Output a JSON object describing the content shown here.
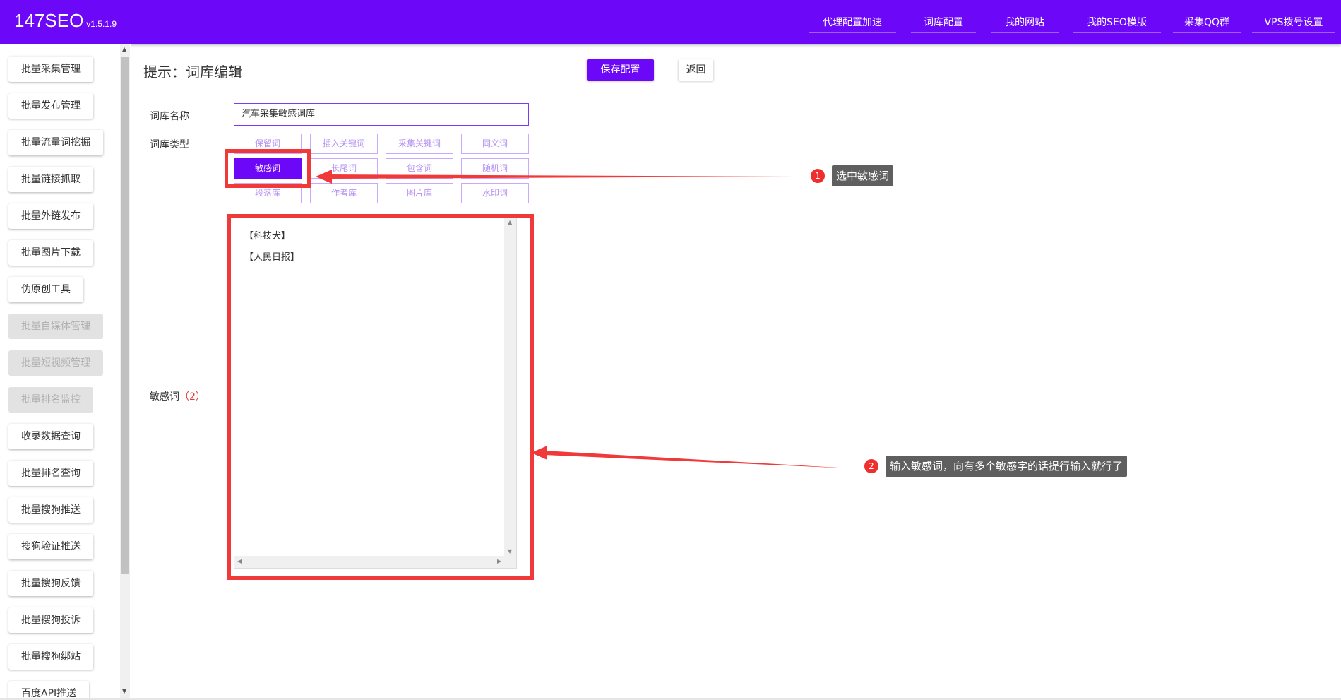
{
  "header": {
    "app_name": "147SEO",
    "version": "v1.5.1.9",
    "nav": [
      "代理配置加速",
      "词库配置",
      "我的网站",
      "我的SEO模版",
      "采集QQ群",
      "VPS拨号设置"
    ]
  },
  "sidebar": {
    "items": [
      {
        "label": "批量采集管理",
        "disabled": false
      },
      {
        "label": "批量发布管理",
        "disabled": false
      },
      {
        "label": "批量流量词挖掘",
        "disabled": false
      },
      {
        "label": "批量链接抓取",
        "disabled": false
      },
      {
        "label": "批量外链发布",
        "disabled": false
      },
      {
        "label": "批量图片下载",
        "disabled": false
      },
      {
        "label": "伪原创工具",
        "disabled": false
      },
      {
        "label": "批量自媒体管理",
        "disabled": true
      },
      {
        "label": "批量短视频管理",
        "disabled": true
      },
      {
        "label": "批量排名监控",
        "disabled": true
      },
      {
        "label": "收录数据查询",
        "disabled": false
      },
      {
        "label": "批量排名查询",
        "disabled": false
      },
      {
        "label": "批量搜狗推送",
        "disabled": false
      },
      {
        "label": "搜狗验证推送",
        "disabled": false
      },
      {
        "label": "批量搜狗反馈",
        "disabled": false
      },
      {
        "label": "批量搜狗投诉",
        "disabled": false
      },
      {
        "label": "批量搜狗绑站",
        "disabled": false
      },
      {
        "label": "百度API推送",
        "disabled": false
      }
    ]
  },
  "page": {
    "title": "提示：词库编辑",
    "save_label": "保存配置",
    "back_label": "返回"
  },
  "form": {
    "name_label": "词库名称",
    "name_value": "汽车采集敏感词库",
    "type_label": "词库类型",
    "types": [
      "保留词",
      "插入关键词",
      "采集关键词",
      "同义词",
      "敏感词",
      "长尾词",
      "包含词",
      "随机词",
      "段落库",
      "作者库",
      "图片库",
      "水印词"
    ],
    "selected_type": "敏感词",
    "words_label": "敏感词",
    "words_count": "（2）",
    "words": [
      "【科技犬】",
      "【人民日报】"
    ]
  },
  "annotations": {
    "step1_number": "1",
    "step1_text": "选中敏感词",
    "step2_number": "2",
    "step2_text": "输入敏感词，向有多个敏感字的话提行输入就行了",
    "color": "#f03a3a"
  },
  "colors": {
    "brand": "#6d07f8",
    "accent_red": "#f03a3a"
  }
}
